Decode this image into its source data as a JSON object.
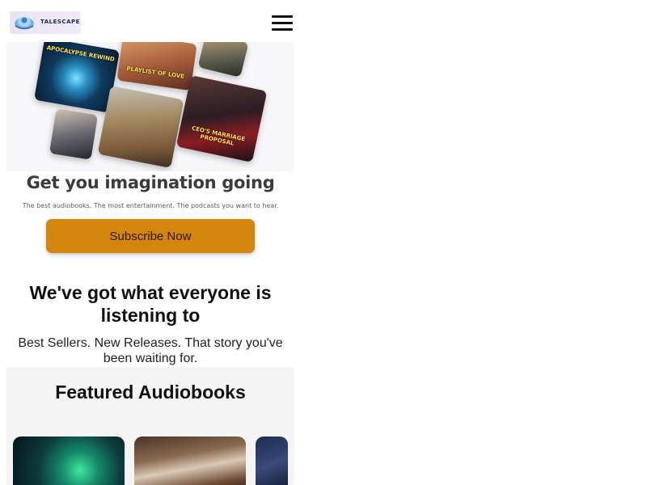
{
  "header": {
    "logo_text": "TALESCAPE",
    "menu_icon": "hamburger-menu-icon"
  },
  "hero": {
    "covers": [
      {
        "title": "APOCALYPSE REWIND"
      },
      {
        "title": "PLAYLIST OF LOVE"
      },
      {
        "title": "CEO'S MARRIAGE PROPOSAL"
      }
    ],
    "title": "Get you imagination going",
    "subtitle": "The best audiobooks. The most entertainment. The podcasts you want to hear.",
    "cta_label": "Subscribe Now"
  },
  "section_listening": {
    "title": "We've got what everyone is listening to",
    "subtitle": "Best Sellers. New Releases. That story you've been waiting for."
  },
  "featured": {
    "title": "Featured Audiobooks"
  },
  "colors": {
    "accent": "#d4850e",
    "featured_bg": "#f4f4f4",
    "heading": "#111111"
  }
}
